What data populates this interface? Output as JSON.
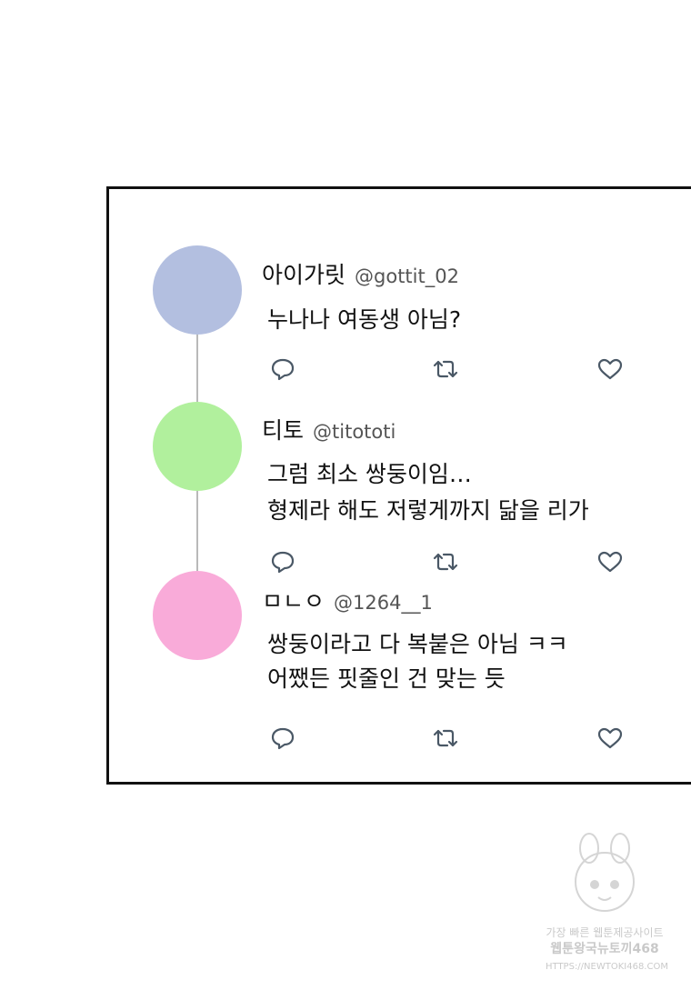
{
  "posts": [
    {
      "display_name": "아이가릿",
      "handle": "@gottit_02",
      "text_lines": [
        "누나나 여동생 아님?"
      ],
      "avatar_color": "#b3bfe0"
    },
    {
      "display_name": "티토",
      "handle": "@titototi",
      "text_lines": [
        "그럼 최소 쌍둥이임…",
        "형제라 해도 저렇게까지 닮을 리가"
      ],
      "avatar_color": "#b1f09d"
    },
    {
      "display_name": "ㅁㄴㅇ",
      "handle": "@1264__1",
      "text_lines": [
        "쌍둥이라고 다 복붙은 아님 ㅋㅋ",
        "어쨌든 핏줄인 건 맞는 듯"
      ],
      "avatar_color": "#f9abd9"
    }
  ],
  "icons": {
    "reply": "reply-icon",
    "retweet": "retweet-icon",
    "like": "heart-icon"
  },
  "colors": {
    "icon": "#4a5866",
    "thread_line": "#b9b9b9",
    "border": "#111111"
  },
  "watermark": {
    "line1": "가장 빠른 웹툰제공사이트",
    "line2": "웹툰왕국뉴토끼468",
    "line3": "HTTPS://NEWTOKI468.COM"
  }
}
